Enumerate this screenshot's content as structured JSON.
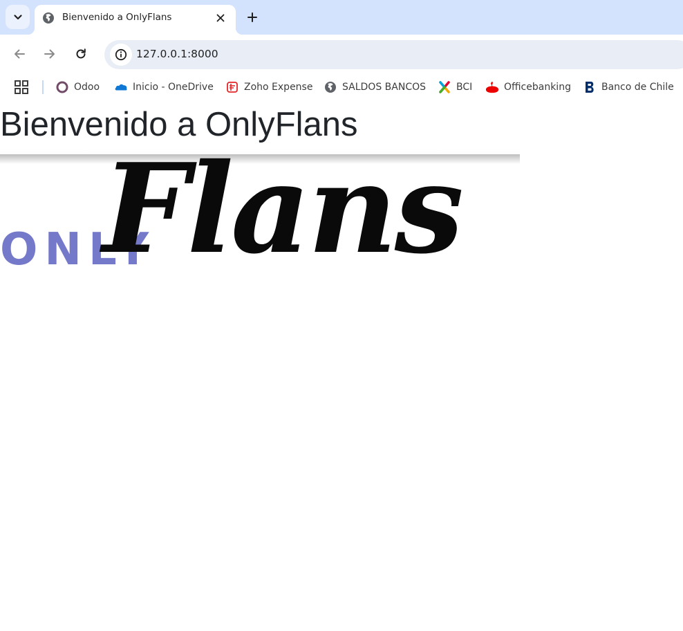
{
  "browser": {
    "tab": {
      "title": "Bienvenido a OnlyFlans"
    },
    "address_bar": {
      "url": "127.0.0.1:8000"
    },
    "bookmarks": [
      {
        "label": "Odoo",
        "icon": "odoo-icon"
      },
      {
        "label": "Inicio - OneDrive",
        "icon": "onedrive-icon"
      },
      {
        "label": "Zoho Expense",
        "icon": "zoho-icon"
      },
      {
        "label": "SALDOS BANCOS",
        "icon": "globe-icon"
      },
      {
        "label": "BCI",
        "icon": "bci-icon"
      },
      {
        "label": "Officebanking",
        "icon": "santander-icon"
      },
      {
        "label": "Banco de Chile",
        "icon": "banco-de-chile-icon"
      }
    ]
  },
  "page": {
    "heading": "Bienvenido a OnlyFlans",
    "logo": {
      "word_only": "ONLY",
      "word_flans": "Flans"
    }
  },
  "colors": {
    "tabstrip_bg": "#d3e3fd",
    "omnibox_bg": "#e9eef6",
    "heading_text": "#212529",
    "logo_only": "#7479c9",
    "logo_flans": "#0a0a0a"
  }
}
